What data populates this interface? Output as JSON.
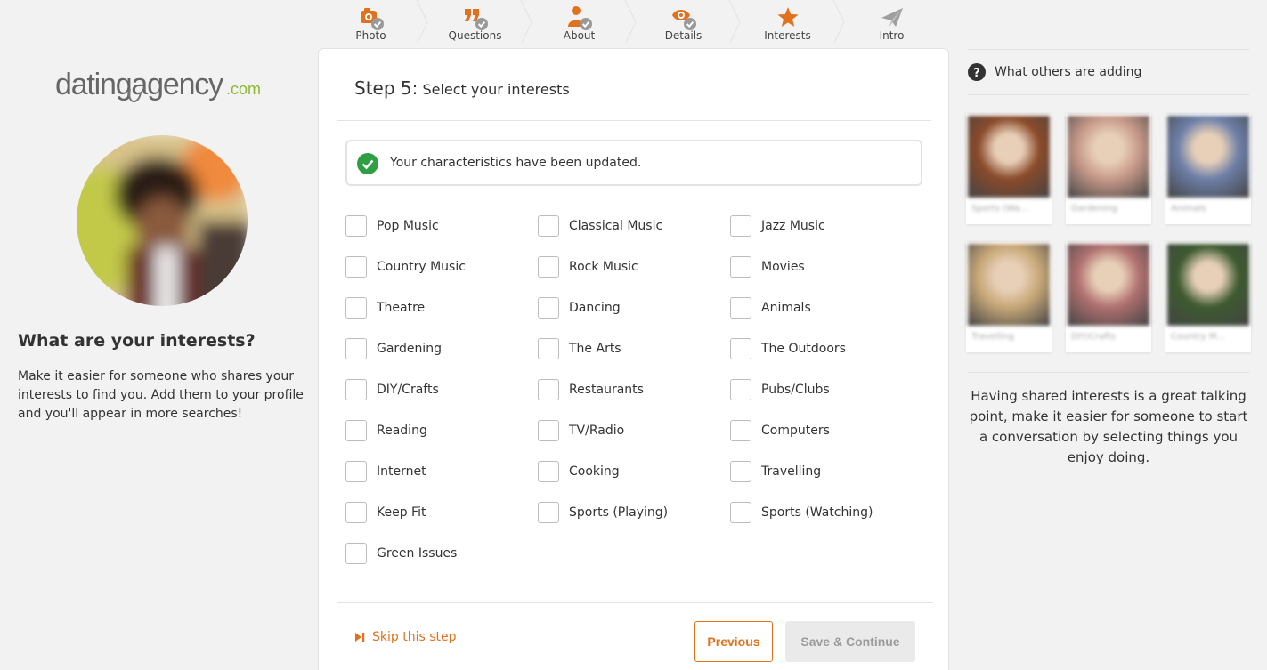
{
  "colors": {
    "accent": "#e2711d",
    "check_badge": "#999999",
    "success": "#2ea043",
    "inactive_icon": "#9e9e9e"
  },
  "steps": [
    {
      "label": "Photo",
      "icon": "camera-icon",
      "done": true
    },
    {
      "label": "Questions",
      "icon": "quote-icon",
      "done": true
    },
    {
      "label": "About",
      "icon": "person-icon",
      "done": true
    },
    {
      "label": "Details",
      "icon": "eye-icon",
      "done": true
    },
    {
      "label": "Interests",
      "icon": "star-icon",
      "active": true
    },
    {
      "label": "Intro",
      "icon": "paper-plane-icon"
    }
  ],
  "brand": {
    "logo_text_main": "datingagency",
    "logo_text_suffix": ".com"
  },
  "left": {
    "title": "What are your interests?",
    "description": "Make it easier for someone who shares your interests to find you. Add them to your profile and you'll appear in more searches!"
  },
  "main": {
    "step_number": "Step 5:",
    "step_title": "Select your interests",
    "alert": "Your characteristics have been updated.",
    "interests": [
      "Pop Music",
      "Classical Music",
      "Jazz Music",
      "Country Music",
      "Rock Music",
      "Movies",
      "Theatre",
      "Dancing",
      "Animals",
      "Gardening",
      "The Arts",
      "The Outdoors",
      "DIY/Crafts",
      "Restaurants",
      "Pubs/Clubs",
      "Reading",
      "TV/Radio",
      "Computers",
      "Internet",
      "Cooking",
      "Travelling",
      "Keep Fit",
      "Sports (Playing)",
      "Sports (Watching)",
      "Green Issues"
    ],
    "skip_label": "Skip this step",
    "previous_label": "Previous",
    "save_label": "Save & Continue"
  },
  "right": {
    "heading": "What others are adding",
    "tiles": [
      {
        "caption": "Sports (Wa...",
        "tone": "#8a4a2a"
      },
      {
        "caption": "Gardening",
        "tone": "#c89a8a"
      },
      {
        "caption": "Animals",
        "tone": "#6d7fa8"
      },
      {
        "caption": "Travelling",
        "tone": "#c8a878"
      },
      {
        "caption": "DIY/Crafts",
        "tone": "#b07070"
      },
      {
        "caption": "Country M...",
        "tone": "#3d5a30"
      }
    ],
    "description": "Having shared interests is a great talking point, make it easier for someone to start a conversation by selecting things you enjoy doing."
  }
}
